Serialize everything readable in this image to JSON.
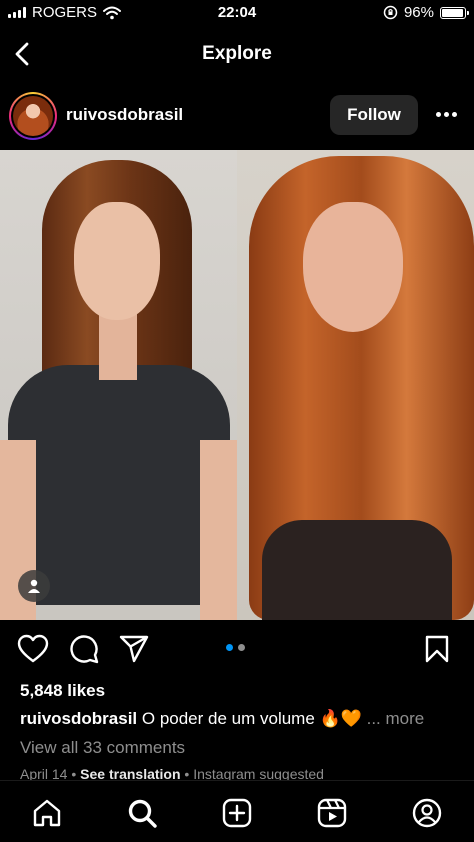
{
  "status_bar": {
    "carrier": "ROGERS",
    "time": "22:04",
    "battery": "96%",
    "battery_level": 0.96
  },
  "header": {
    "title": "Explore",
    "back_icon": "chevron-left-icon"
  },
  "post": {
    "username": "ruivosdobrasil",
    "follow_label": "Follow",
    "more_icon": "ellipsis-icon",
    "carousel": {
      "count": 2,
      "active": 1
    },
    "likes": "5,848 likes",
    "caption_user": "ruivosdobrasil",
    "caption_text": "O poder de um volume 🔥🧡",
    "caption_more": "... more",
    "comments_link": "View all 33 comments",
    "date": "April 14",
    "see_translation": "See translation",
    "suggested": "Instagram suggested",
    "separator": " • "
  },
  "actions": {
    "like_icon": "heart-icon",
    "comment_icon": "comment-icon",
    "share_icon": "send-icon",
    "save_icon": "bookmark-icon"
  },
  "tab_bar": {
    "items": [
      "home-icon",
      "search-icon",
      "add-post-icon",
      "reels-icon",
      "profile-icon"
    ],
    "active": "search-icon"
  },
  "colors": {
    "background": "#000000",
    "follow_button": "#262626",
    "muted_text": "#8e8e8e",
    "carousel_active": "#0095f6",
    "carousel_inactive": "#8e8e8e"
  }
}
